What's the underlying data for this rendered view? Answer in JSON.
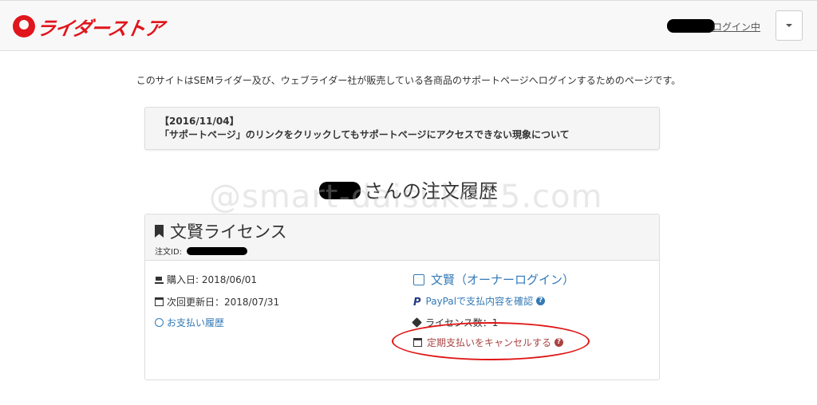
{
  "header": {
    "logo_text": "ライダーストア",
    "login_status": "ログイン中",
    "colors": {
      "brand": "#e0151d"
    }
  },
  "intro_text": "このサイトはSEMライダー及び、ウェブライダー社が販売している各商品のサポートページへログインするためのページです。",
  "notice": {
    "date": "【2016/11/04】",
    "title": "「サポートページ」のリンクをクリックしてもサポートページにアクセスできない現象について"
  },
  "page_title_suffix": "さんの注文履歴",
  "watermark": "@smart-daisuke15.com",
  "order": {
    "product_name": "文賢ライセンス",
    "order_id_label": "注文ID:",
    "purchase_date": "購入日: 2018/06/01",
    "next_renewal": "次回更新日：2018/07/31",
    "payment_history": "お支払い履歴",
    "owner_login": "文賢（オーナーログイン）",
    "paypal_check": "PayPalで支払内容を確認",
    "license_count": "ライセンス数：1",
    "cancel_subscription": "定期支払いをキャンセルする",
    "help_glyph": "?",
    "icons": [
      "bookmark-icon",
      "cart-icon",
      "calendar-icon",
      "history-icon",
      "edit-icon",
      "paypal-icon",
      "tag-icon",
      "calendar-x-icon",
      "help-icon"
    ]
  }
}
